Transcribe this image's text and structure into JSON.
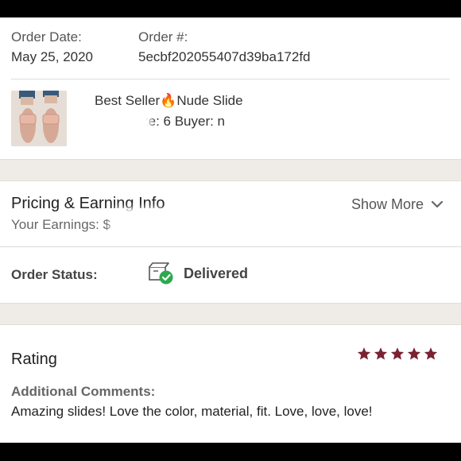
{
  "order": {
    "date_label": "Order Date:",
    "date_value": "May 25, 2020",
    "number_label": "Order #:",
    "number_value": "5ecbf202055407d39ba172fd"
  },
  "product": {
    "title": "Best Seller🔥Nude Slide",
    "size_buyer": "Size: 6  Buyer: n"
  },
  "pricing": {
    "title": "Pricing & Earning Info",
    "earnings_label": "Your Earnings: $",
    "show_more": "Show More",
    "status_label": "Order Status:",
    "status_value": "Delivered",
    "status_color": "#2fa84f"
  },
  "rating": {
    "title": "Rating",
    "stars": 5,
    "star_color": "#7a2231",
    "comments_label": "Additional Comments:",
    "comments_text": "Amazing slides! Love the color, material, fit. Love, love, love!"
  }
}
